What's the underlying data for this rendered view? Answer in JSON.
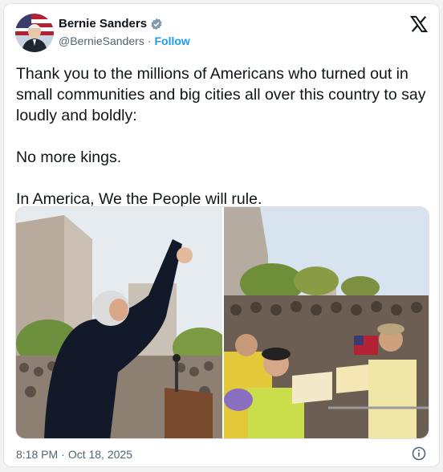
{
  "post": {
    "author_name": "Bernie Sanders",
    "handle": "@BernieSanders",
    "separator": "·",
    "follow_label": "Follow",
    "paragraphs": [
      "Thank you to the millions of Americans who turned out in small communities and big cities all over this country to say loudly and boldly:",
      "No more kings.",
      "In America, We the People will rule."
    ],
    "time": "8:18 PM",
    "date_separator": "·",
    "date": "Oct 18, 2025"
  },
  "icons": {
    "verified": "verified-badge-icon",
    "platform": "x-logo-icon",
    "info": "info-icon"
  },
  "colors": {
    "accent": "#1d9bf0",
    "text": "#0f1419",
    "muted": "#536471"
  }
}
